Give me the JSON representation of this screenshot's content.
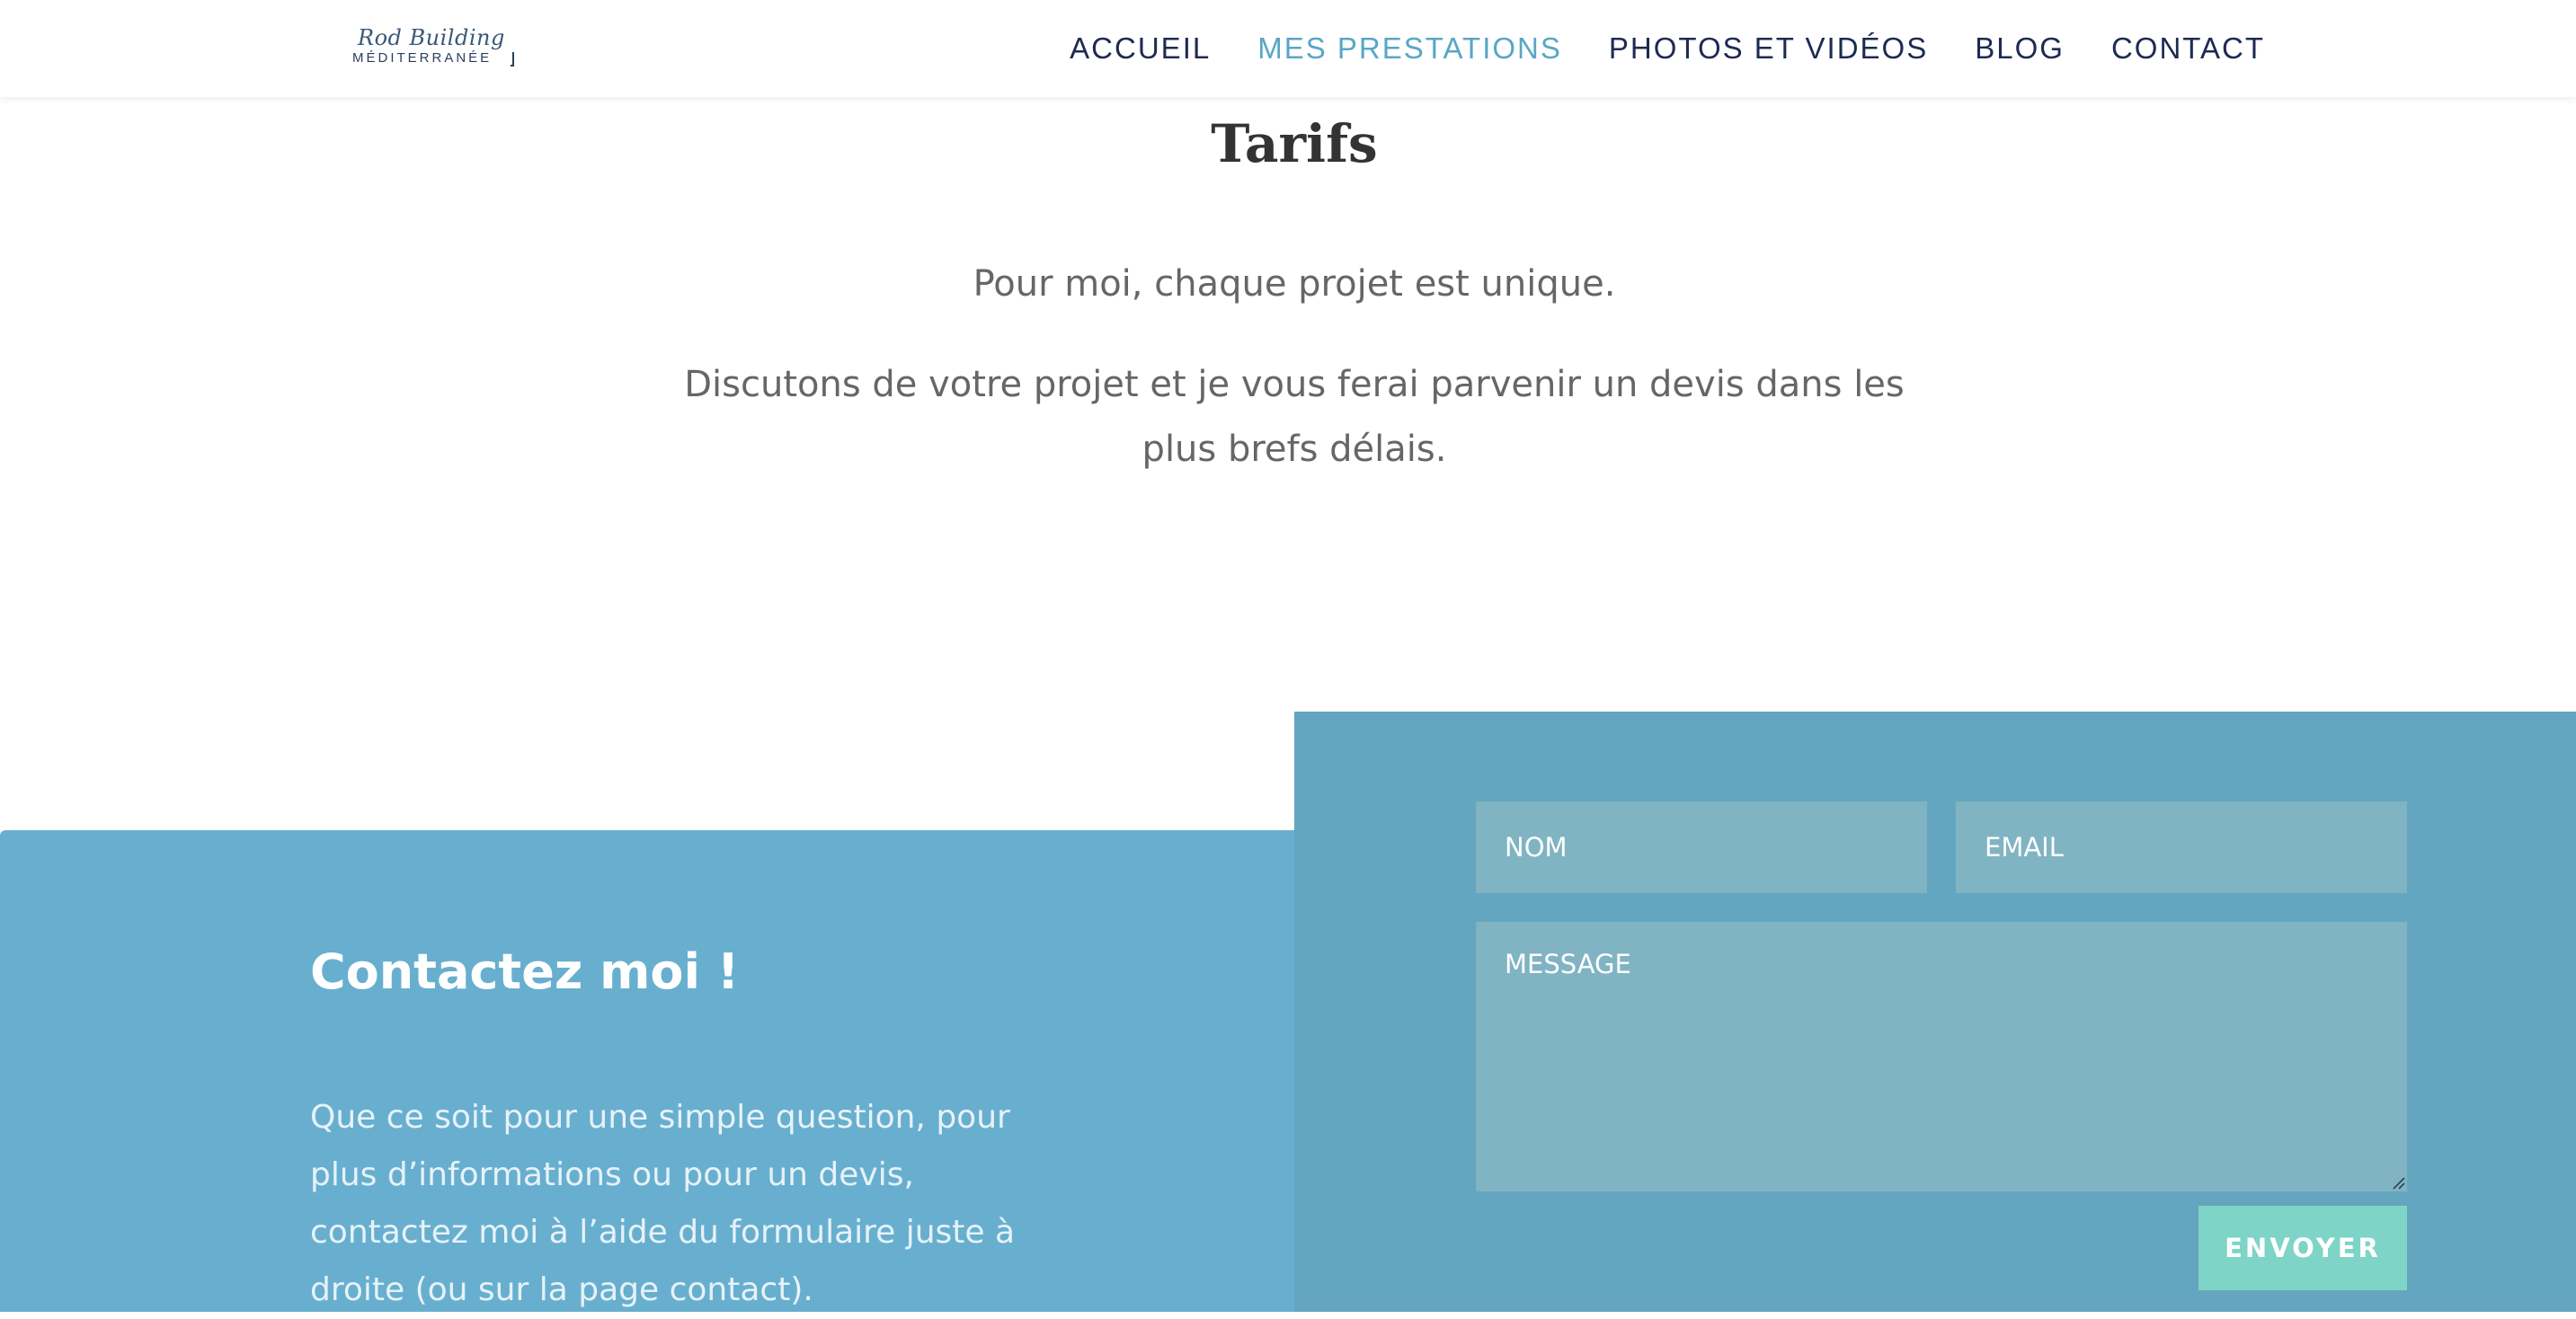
{
  "header": {
    "logo": {
      "script": "Rod Building",
      "subtitle": "MÉDITERRANÉE"
    },
    "nav": [
      {
        "label": "ACCUEIL",
        "active": false
      },
      {
        "label": "MES PRESTATIONS",
        "active": true
      },
      {
        "label": "PHOTOS ET VIDÉOS",
        "active": false
      },
      {
        "label": "BLOG",
        "active": false
      },
      {
        "label": "CONTACT",
        "active": false
      }
    ]
  },
  "tarifs": {
    "title": "Tarifs",
    "paragraphs": [
      "Pour moi, chaque projet est unique.",
      "Discutons de votre projet et je vous ferai parvenir un devis dans les plus brefs délais."
    ]
  },
  "contact": {
    "title": "Contactez moi !",
    "text": "Que ce soit pour une simple question, pour plus d’informations ou pour un devis, contactez moi à l’aide du formulaire juste à droite (ou sur la page contact).",
    "form": {
      "name_placeholder": "NOM",
      "email_placeholder": "EMAIL",
      "message_placeholder": "MESSAGE",
      "submit_label": "ENVOYER"
    }
  },
  "colors": {
    "nav_text": "#1d2a52",
    "nav_active": "#5aa6c6",
    "contact_left_bg": "#68afcf",
    "contact_right_bg": "#64a6bf",
    "field_bg": "#80b4c3",
    "submit_bg": "#7dd4c7"
  }
}
